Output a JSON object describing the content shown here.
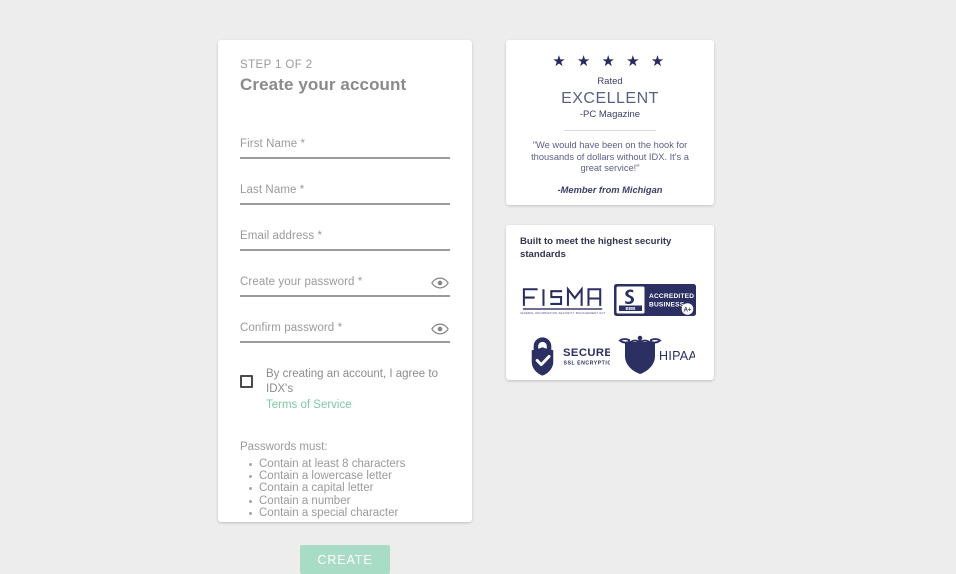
{
  "theme": {
    "page_bg": "#ededed",
    "card_bg": "#ffffff",
    "accent_green": "#7ec9a5",
    "button_green": "#a8dcc4",
    "navy": "#262a5e"
  },
  "signup": {
    "step_label": "STEP 1 OF 2",
    "title": "Create your account",
    "fields": [
      {
        "label": "First Name *",
        "value": "",
        "type": "text",
        "name": "first-name"
      },
      {
        "label": "Last Name *",
        "value": "",
        "type": "text",
        "name": "last-name"
      },
      {
        "label": "Email address *",
        "value": "",
        "type": "email",
        "name": "email-address"
      },
      {
        "label": "Create your password *",
        "value": "",
        "type": "password",
        "name": "create-password"
      },
      {
        "label": "Confirm password *",
        "value": "",
        "type": "password",
        "name": "confirm-password"
      }
    ],
    "terms": {
      "checkbox_checked": "false",
      "text": "By creating an account, I agree to IDX's",
      "link_label": "Terms of Service"
    },
    "password_rules": {
      "title": "Passwords must:",
      "items": [
        "Contain at least 8 characters",
        "Contain a lowercase letter",
        "Contain a capital letter",
        "Contain a number",
        "Contain a special character"
      ]
    },
    "submit_label": "CREATE"
  },
  "review": {
    "stars": "★ ★ ★ ★ ★",
    "star_count": 5,
    "rated_label": "Rated",
    "rating_word": "EXCELLENT",
    "source": "-PC Magazine",
    "quote": "\"We would have been on the hook for thousands of dollars without IDX. It's a great service!\"",
    "attribution": "-Member from Michigan"
  },
  "security": {
    "title": "Built to meet the highest security standards",
    "badges": [
      {
        "name": "fisma-badge",
        "title": "FISMA",
        "subtitle": "FEDERAL INFORMATION SECURITY MANAGEMENT ACT"
      },
      {
        "name": "bbb-accredited-business-badge",
        "title": "BBB",
        "line1": "ACCREDITED",
        "line2": "BUSINESS",
        "grade": "A+"
      },
      {
        "name": "ssl-secure-badge",
        "title": "SECURE",
        "subtitle": "SSL ENCRYPTION"
      },
      {
        "name": "hipaa-badge",
        "title": "HIPAA"
      }
    ]
  }
}
